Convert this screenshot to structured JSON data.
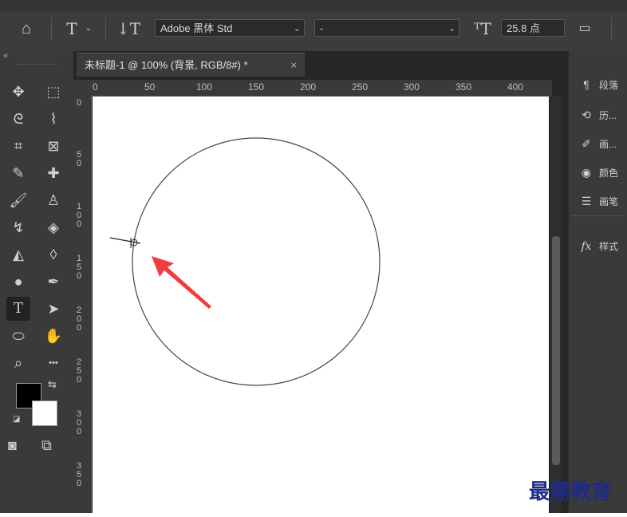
{
  "options_bar": {
    "home_icon": "home-icon",
    "type_tool_icon": "type-tool-icon",
    "orientation_icon": "text-orientation-icon",
    "font_family": "Adobe 黑体 Std",
    "font_style": "-",
    "font_size_icon": "font-size-icon",
    "font_size": "25.8 点",
    "panel_toggle_icon": "panel-toggle-icon"
  },
  "document": {
    "tab_title": "未标题-1 @ 100% (背景, RGB/8#) *",
    "tab_close": "×",
    "h_ruler": [
      "0",
      "50",
      "100",
      "150",
      "200",
      "250",
      "300",
      "350",
      "400"
    ],
    "v_ruler": [
      "0",
      "5\n0",
      "1\n0\n0",
      "1\n5\n0",
      "2\n0\n0",
      "2\n5\n0",
      "3\n0\n0",
      "3\n5\n0"
    ]
  },
  "toolbar": {
    "collapse": "«",
    "tools": [
      {
        "name": "move-tool",
        "glyph": "✥"
      },
      {
        "name": "marquee-tool",
        "glyph": "⬚"
      },
      {
        "name": "lasso-tool",
        "glyph": "ᘓ"
      },
      {
        "name": "quick-selection-tool",
        "glyph": "⌇"
      },
      {
        "name": "crop-tool",
        "glyph": "⌗"
      },
      {
        "name": "frame-tool",
        "glyph": "⊠"
      },
      {
        "name": "eyedropper-tool",
        "glyph": "✎"
      },
      {
        "name": "healing-tool",
        "glyph": "✚"
      },
      {
        "name": "brush-tool",
        "glyph": "🖌"
      },
      {
        "name": "stamp-tool",
        "glyph": "♙"
      },
      {
        "name": "history-brush-tool",
        "glyph": "↯"
      },
      {
        "name": "eraser-tool",
        "glyph": "◈"
      },
      {
        "name": "paint-bucket-tool",
        "glyph": "◭"
      },
      {
        "name": "blur-tool",
        "glyph": "◊"
      },
      {
        "name": "dodge-tool",
        "glyph": "●"
      },
      {
        "name": "pen-tool",
        "glyph": "✒"
      },
      {
        "name": "type-tool",
        "glyph": "T"
      },
      {
        "name": "path-selection-tool",
        "glyph": "➤"
      },
      {
        "name": "ellipse-tool",
        "glyph": "⬭"
      },
      {
        "name": "hand-tool",
        "glyph": "✋"
      },
      {
        "name": "zoom-tool",
        "glyph": "⌕"
      },
      {
        "name": "more-tools",
        "glyph": "•••"
      }
    ]
  },
  "right_panel": {
    "items": [
      {
        "icon": "paragraph-icon",
        "glyph": "¶",
        "label": "段落"
      },
      {
        "icon": "history-icon",
        "glyph": "⟲",
        "label": "历..."
      },
      {
        "icon": "brush-settings-icon",
        "glyph": "✐",
        "label": "画..."
      },
      {
        "icon": "color-icon",
        "glyph": "◉",
        "label": "颜色"
      },
      {
        "icon": "brush-presets-icon",
        "glyph": "☰",
        "label": "画笔"
      },
      {
        "icon": "styles-icon",
        "glyph": "fx",
        "label": "样式"
      }
    ]
  },
  "colors": {
    "foreground": "#000000",
    "background": "#ffffff",
    "arrow": "#f03c3c",
    "watermark": "#1f2b8c"
  },
  "watermark": "最需教育"
}
